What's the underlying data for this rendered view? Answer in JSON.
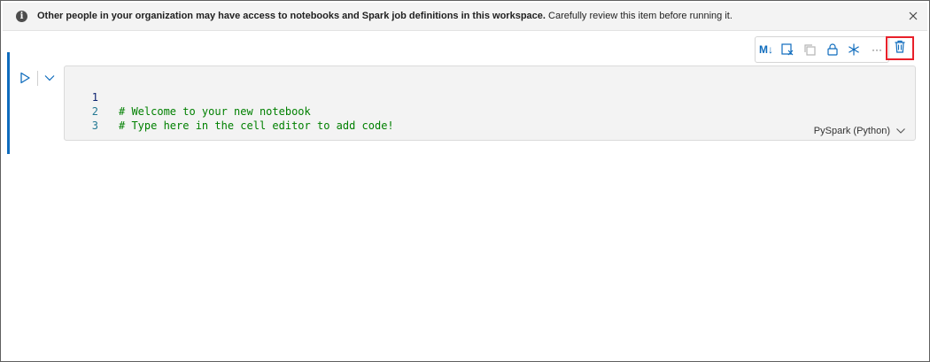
{
  "banner": {
    "bold_text": "Other people in your organization may have access to notebooks and Spark job definitions in this workspace.",
    "text": " Carefully review this item before running it.",
    "info_icon": "info-icon",
    "close_icon": "close-icon"
  },
  "toolbar": {
    "markdown_label": "M↓",
    "buttons": [
      "markdown-toggle-icon",
      "select-cell-icon",
      "copy-cell-icon",
      "lock-icon",
      "freeze-icon",
      "more-options-icon",
      "delete-icon"
    ],
    "more_label": "···"
  },
  "cell": {
    "lines": [
      {
        "number": "1",
        "code": "# Welcome to your new notebook"
      },
      {
        "number": "2",
        "code": "# Type here in the cell editor to add code!"
      },
      {
        "number": "3",
        "code": ""
      }
    ],
    "language": "PySpark (Python)"
  },
  "colors": {
    "accent": "#0f6cbd",
    "comment": "#008000",
    "line_number": "#237893",
    "highlight_border": "#e8202a"
  }
}
